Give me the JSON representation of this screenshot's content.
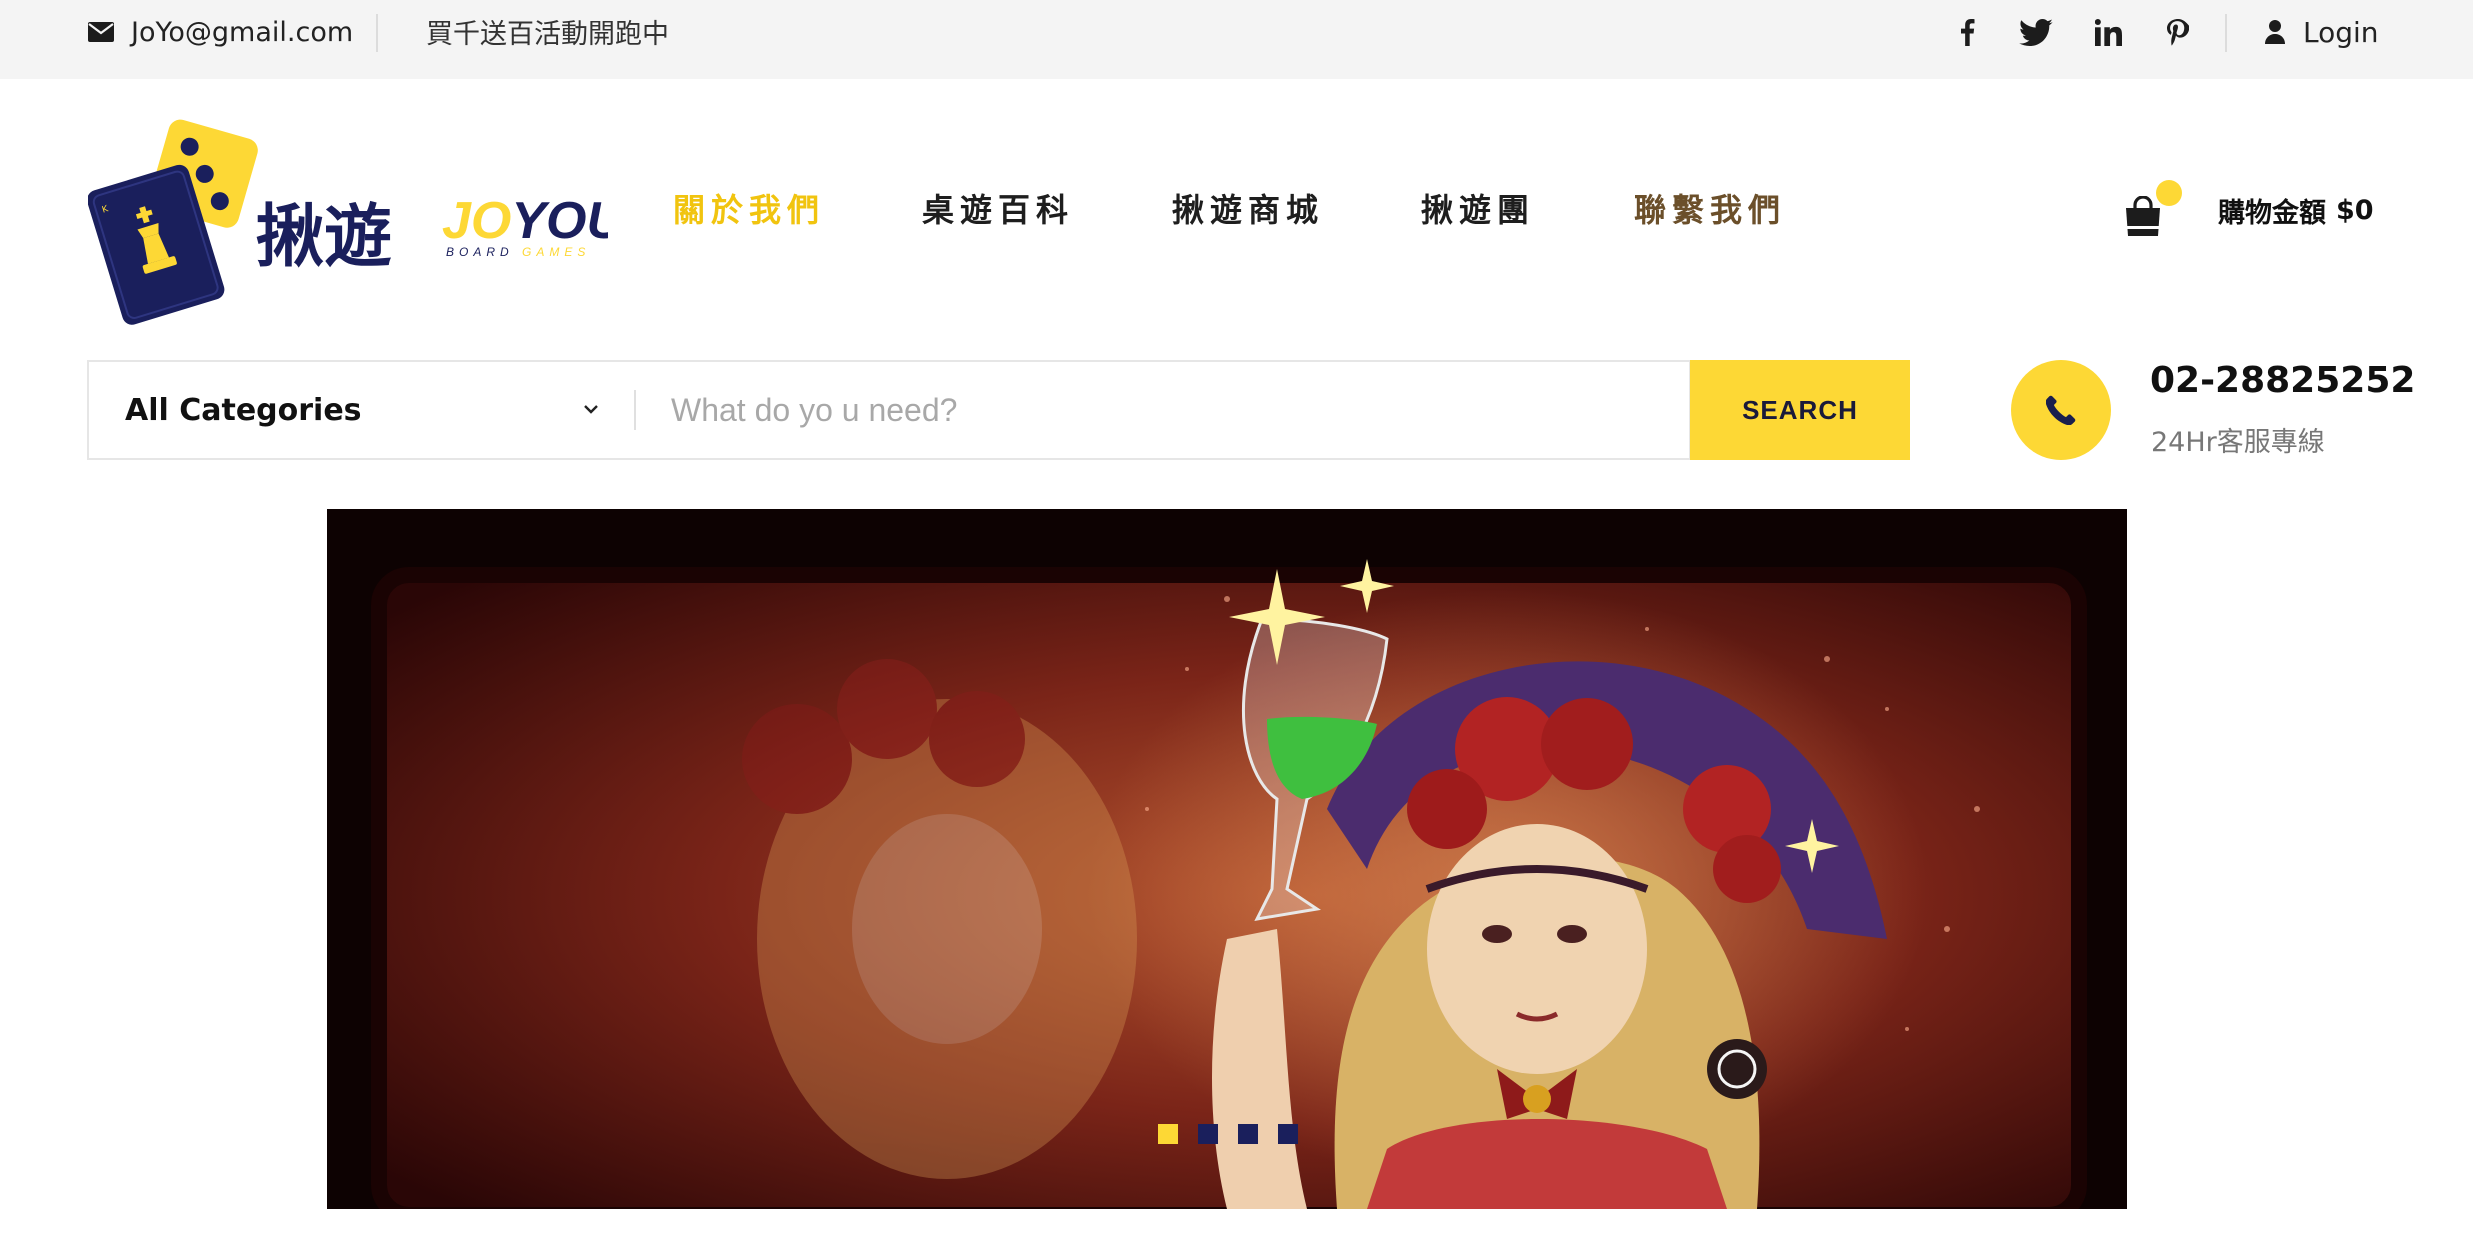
{
  "topbar": {
    "email": "JoYo@gmail.com",
    "promo": "買千送百活動開跑中",
    "social": [
      "facebook-icon",
      "twitter-icon",
      "linkedin-icon",
      "pinterest-icon"
    ],
    "login_label": "Login"
  },
  "logo": {
    "chinese_name": "揪遊",
    "brand_jo": "JO",
    "brand_you": "YOU",
    "board": "BOARD",
    "games": "GAMES"
  },
  "nav": {
    "items": [
      {
        "label": "關於我們",
        "state": "active"
      },
      {
        "label": "桌遊百科",
        "state": "normal"
      },
      {
        "label": "揪遊商城",
        "state": "normal"
      },
      {
        "label": "揪遊團",
        "state": "normal"
      },
      {
        "label": "聯繫我們",
        "state": "normal"
      }
    ]
  },
  "cart": {
    "label": "購物金額",
    "amount": "$0"
  },
  "search": {
    "category": "All Categories",
    "placeholder": "What do yo u need?",
    "button": "SEARCH"
  },
  "contact": {
    "phone": "02-28825252",
    "sub": "24Hr客服專線"
  },
  "slider": {
    "dot_count": 4,
    "active_index": 0
  },
  "colors": {
    "accent": "#fdd835",
    "navy": "#1a1f5c",
    "topbar_bg": "#f4f4f4"
  }
}
